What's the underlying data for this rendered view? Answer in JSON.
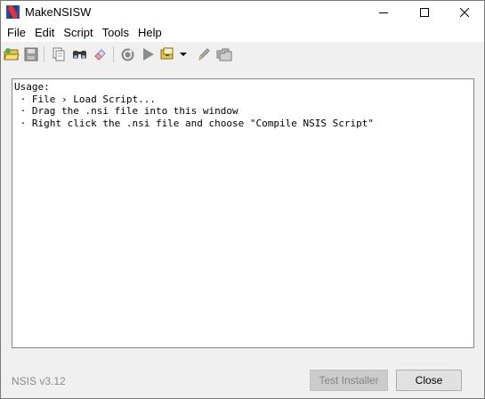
{
  "window": {
    "title": "MakeNSISW"
  },
  "menu": {
    "items": [
      {
        "label": "File"
      },
      {
        "label": "Edit"
      },
      {
        "label": "Script"
      },
      {
        "label": "Tools"
      },
      {
        "label": "Help"
      }
    ]
  },
  "toolbar": {
    "icons": [
      "open-script-icon",
      "save-icon",
      "copy-icon",
      "find-icon",
      "clear-log-icon",
      "recompile-icon",
      "test-installer-icon",
      "compressor-icon",
      "compressor-dropdown-icon",
      "edit-script-icon",
      "browse-script-icon"
    ]
  },
  "log": {
    "lines": [
      "Usage:",
      "",
      " · File › Load Script...",
      " · Drag the .nsi file into this window",
      " · Right click the .nsi file and choose \"Compile NSIS Script\""
    ]
  },
  "footer": {
    "version": "NSIS v3.12",
    "test_installer_label": "Test Installer",
    "close_label": "Close"
  }
}
